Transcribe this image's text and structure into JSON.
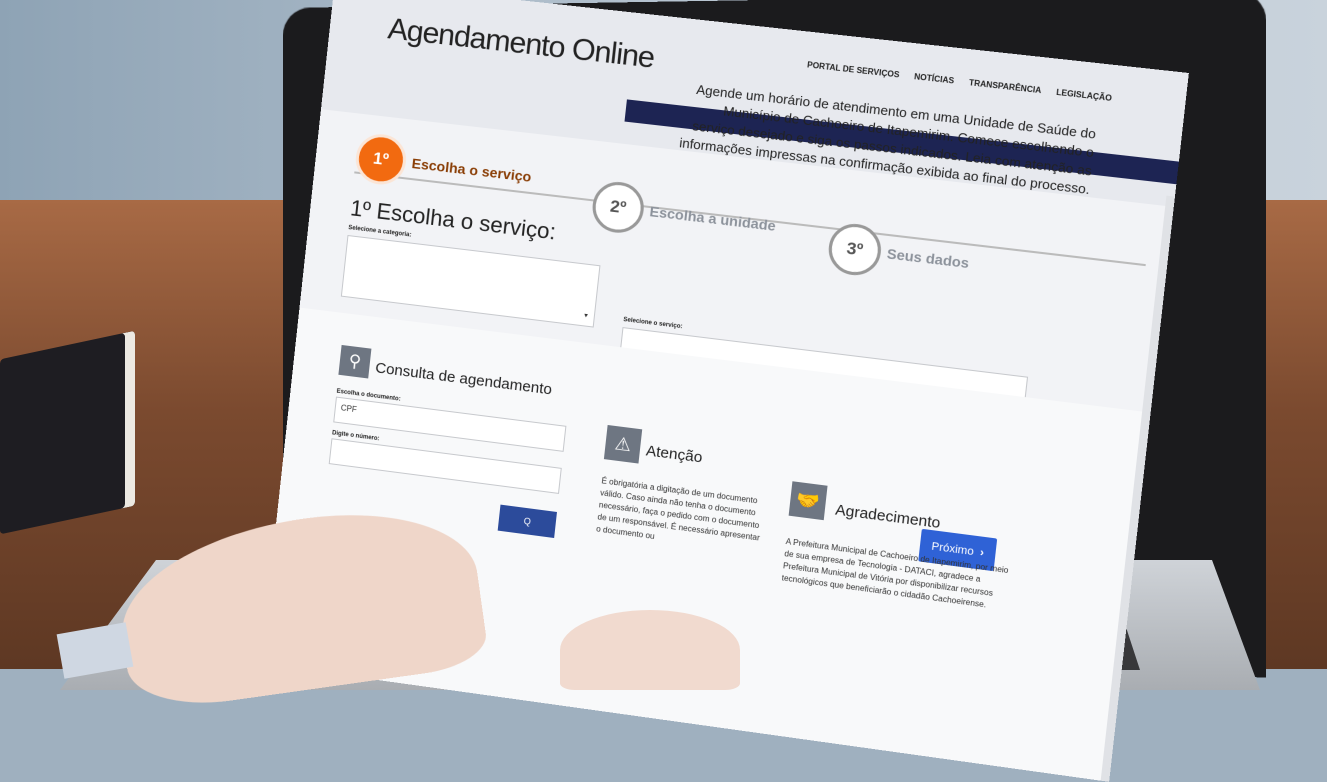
{
  "site": {
    "title": "Agendamento Online",
    "nav": [
      "PORTAL DE SERVIÇOS",
      "NOTÍCIAS",
      "TRANSPARÊNCIA",
      "LEGISLAÇÃO"
    ],
    "intro": "Agende um horário de atendimento em uma Unidade de Saúde do Município de Cachoeiro de Itapemirim. Comece escolhendo o serviço desejado e siga os passos indicados. Leia com atenção as informações impressas na confirmação exibida ao final do processo."
  },
  "steps": [
    {
      "num": "1º",
      "label": "Escolha o serviço",
      "state": "active"
    },
    {
      "num": "2º",
      "label": "Escolha a unidade",
      "state": "inactive"
    },
    {
      "num": "3º",
      "label": "Seus dados",
      "state": "inactive"
    }
  ],
  "form": {
    "title": "1º Escolha o serviço:",
    "category_label": "Selecione a categoria:",
    "category_value": "",
    "service_label": "Selecione o serviço:",
    "service_value": "",
    "next_button": "Próximo"
  },
  "consulta": {
    "icon": "search-icon",
    "title": "Consulta de agendamento",
    "doc_label": "Escolha o documento:",
    "doc_value": "CPF",
    "number_label": "Digite o número:",
    "number_value": "",
    "search_button": "Q"
  },
  "atencao": {
    "icon": "warning-icon",
    "title": "Atenção",
    "text": "É obrigatória a digitação de um documento válido. Caso ainda não tenha o documento necessário, faça o pedido com o documento de um responsável. É necessário apresentar o documento ou"
  },
  "agradecimento": {
    "icon": "handshake-icon",
    "title": "Agradecimento",
    "text": "A Prefeitura Municipal de Cachoeiro de Itapemirim, por meio de sua empresa de Tecnologia - DATACI, agradece a Prefeitura Municipal de Vitória por disponibilizar recursos tecnológicos que beneficiarão o cidadão Cachoeirense."
  },
  "colors": {
    "step_active": "#f26a10",
    "header_stripe": "#1d2453",
    "next_button": "#2f62d6"
  }
}
